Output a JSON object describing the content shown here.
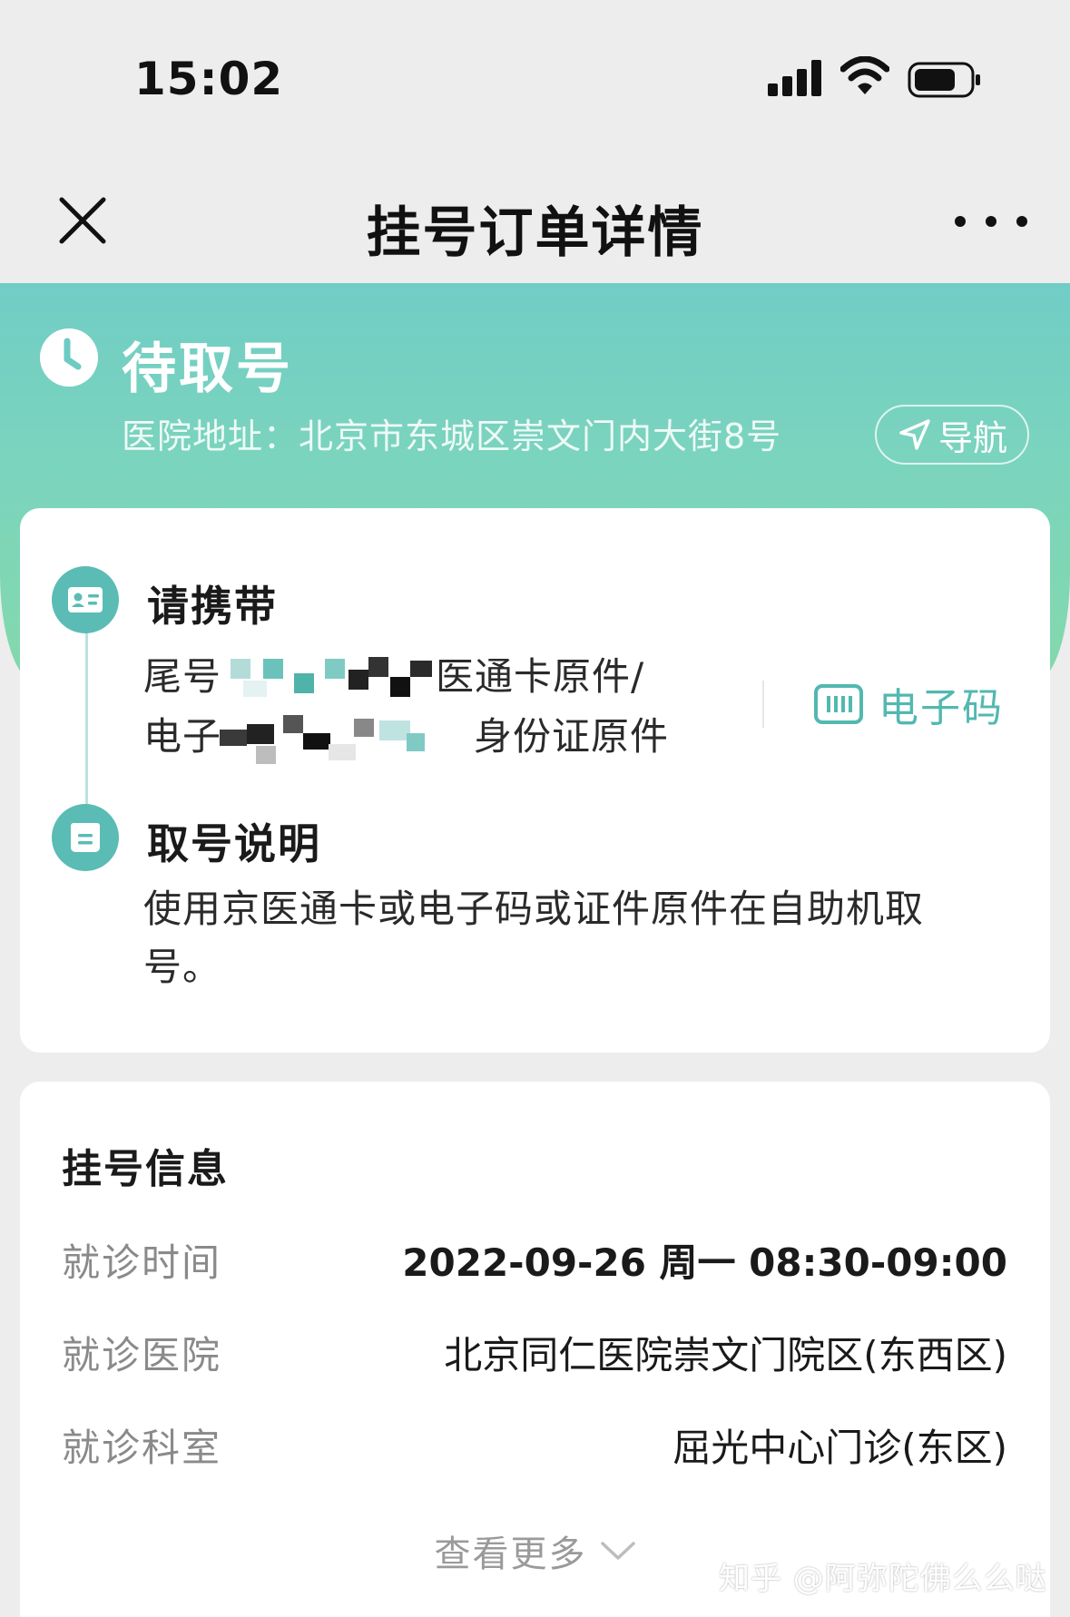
{
  "status_bar": {
    "time": "15:02"
  },
  "nav": {
    "title": "挂号订单详情"
  },
  "banner": {
    "status": "待取号",
    "address": "医院地址：北京市东城区崇文门内大街8号",
    "nav_button": "导航"
  },
  "bring": {
    "title": "请携带",
    "line1_prefix": "尾号",
    "line1_suffix": "医通卡原件/",
    "line2_prefix": "电子",
    "line2_suffix": "身份证原件",
    "ecode_label": "电子码"
  },
  "explain": {
    "title": "取号说明",
    "text": "使用京医通卡或电子码或证件原件在自助机取号。"
  },
  "info": {
    "title": "挂号信息",
    "rows": [
      {
        "label": "就诊时间",
        "value": "2022-09-26 周一 08:30-09:00"
      },
      {
        "label": "就诊医院",
        "value": "北京同仁医院崇文门院区(东西区)"
      },
      {
        "label": "就诊科室",
        "value": "屈光中心门诊(东区)"
      }
    ],
    "see_more": "查看更多"
  },
  "watermark": "知乎 @阿弥陀佛么么哒",
  "colors": {
    "accent": "#52b8b0",
    "banner_start": "#71cdc6",
    "banner_end": "#83d9ac"
  }
}
